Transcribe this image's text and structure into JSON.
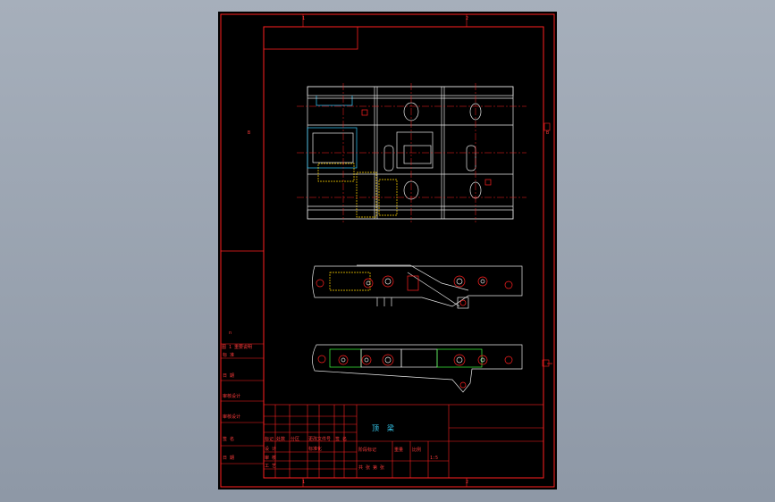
{
  "app": {
    "window_title": "CAD drawing preview",
    "background_color": "#9aa3b0",
    "sheet_color": "#000000",
    "frame_color": "#ff2020",
    "geometry_color": "#e8e8e8",
    "accent_color": "#33ccff",
    "hidden_line_color": "#ffd400",
    "detail_color": "#40ff40"
  },
  "frame": {
    "zone_top_1": "1",
    "zone_top_2": "2",
    "zone_bottom_1": "1",
    "zone_bottom_2": "2",
    "zone_left": "B",
    "zone_right": "B"
  },
  "left_strip": {
    "label_1": "n",
    "label_2": "图 1 重要说明",
    "label_3": "标 准",
    "label_4": "日 期",
    "label_5": "审核设计",
    "label_6": "审核设计",
    "label_7": "签 名",
    "label_8": "日 期"
  },
  "title_block": {
    "drawing_name": "顶 梁",
    "row_label_1": "标记 处数",
    "row_label_2": "分区",
    "row_label_3": "更改文件号",
    "row_label_4": "签 名",
    "row_label_5": "设 计",
    "row_label_6": "标准化",
    "row_label_7": "审 核",
    "row_label_8": "工 艺",
    "stage_label": "阶段标记",
    "weight_label": "重量",
    "scale_label": "比例",
    "scale_value": "1:5",
    "sheet_label": "共 张 第 张"
  }
}
